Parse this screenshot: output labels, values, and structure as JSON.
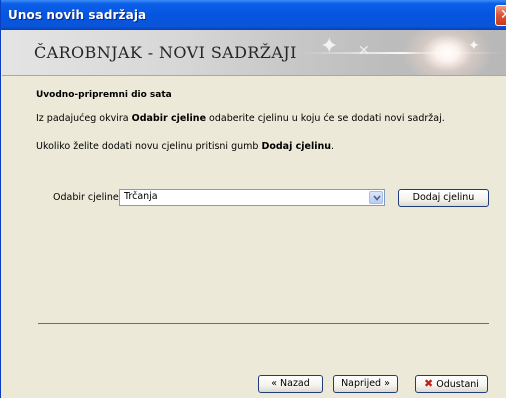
{
  "window": {
    "title": "Unos novih sadržaja"
  },
  "banner": {
    "title": "ČAROBNJAK - NOVI SADRŽAJI"
  },
  "content": {
    "heading": "Uvodno-pripremni dio sata",
    "line1": {
      "prefix": "Iz padajućeg okvira ",
      "bold": "Odabir cjeline",
      "suffix": " odaberite cjelinu u koju će se dodati novi sadržaj."
    },
    "line2": {
      "prefix": "Ukoliko želite dodati novu cjelinu pritisni gumb ",
      "bold": "Dodaj cjelinu",
      "suffix": "."
    }
  },
  "form": {
    "select_label": "Odabir cjeline:",
    "select_value": "Trčanja",
    "add_button": "Dodaj cjelinu"
  },
  "footer": {
    "back_label": "« Nazad",
    "next_label": "Naprijed »",
    "cancel_label": "Odustani"
  },
  "icons": {
    "close": "close-icon",
    "dropdown": "chevron-down-icon",
    "cancel": "cancel-x-icon"
  },
  "colors": {
    "titlebar": "#0655E1",
    "face": "#ECE9D8",
    "cancel_icon": "#C0221B"
  }
}
